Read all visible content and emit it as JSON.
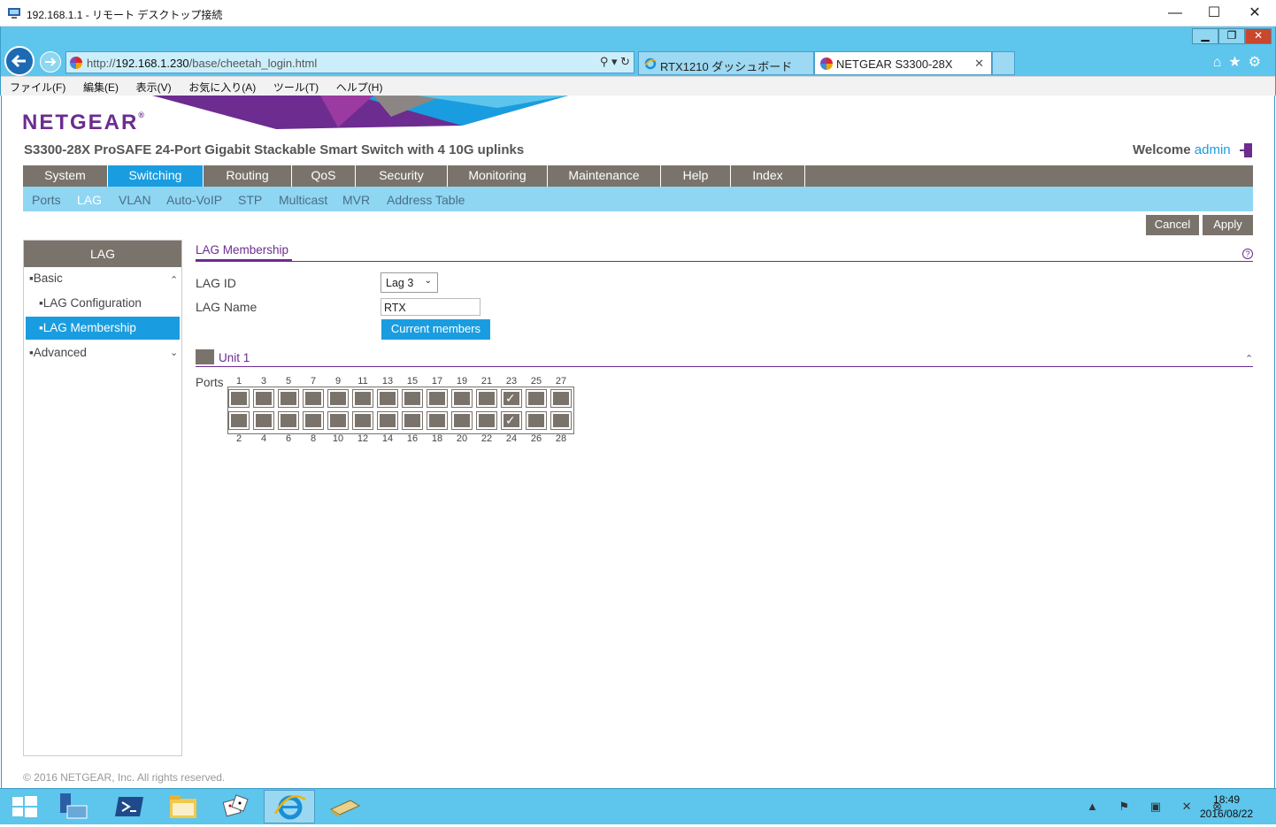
{
  "window": {
    "title": "192.168.1.1 - リモート デスクトップ接続",
    "minimize": "—",
    "maximize": "☐",
    "close": "✕"
  },
  "browser": {
    "url_prefix": "http://",
    "url_host": "192.168.1.230",
    "url_path": "/base/cheetah_login.html",
    "url_tools": "⚲ ▾ ↻",
    "inner_buttons": [
      "▁",
      "❐",
      "✕"
    ],
    "tabs": [
      {
        "label": "RTX1210 ダッシュボード",
        "active": false
      },
      {
        "label": "NETGEAR S3300-28X",
        "active": true,
        "close": "✕"
      }
    ],
    "right_icons": "⌂★⚙",
    "menu": [
      "ファイル(F)",
      "編集(E)",
      "表示(V)",
      "お気に入り(A)",
      "ツール(T)",
      "ヘルプ(H)"
    ]
  },
  "header": {
    "logo": "NETGEAR",
    "logo_reg": "®",
    "product": "S3300-28X ProSAFE 24-Port Gigabit Stackable Smart Switch with 4 10G uplinks",
    "welcome": "Welcome",
    "user": "admin"
  },
  "main_nav": [
    {
      "label": "System",
      "active": false
    },
    {
      "label": "Switching",
      "active": true
    },
    {
      "label": "Routing",
      "active": false
    },
    {
      "label": "QoS",
      "active": false
    },
    {
      "label": "Security",
      "active": false
    },
    {
      "label": "Monitoring",
      "active": false
    },
    {
      "label": "Maintenance",
      "active": false
    },
    {
      "label": "Help",
      "active": false
    },
    {
      "label": "Index",
      "active": false
    }
  ],
  "sub_nav": [
    {
      "label": "Ports",
      "active": false
    },
    {
      "label": "LAG",
      "active": true
    },
    {
      "label": "VLAN",
      "active": false
    },
    {
      "label": "Auto-VoIP",
      "active": false
    },
    {
      "label": "STP",
      "active": false
    },
    {
      "label": "Multicast",
      "active": false
    },
    {
      "label": "MVR",
      "active": false
    },
    {
      "label": "Address Table",
      "active": false
    }
  ],
  "actions": {
    "cancel": "Cancel",
    "apply": "Apply"
  },
  "sidebar": {
    "title": "LAG",
    "basic": "Basic",
    "lag_configuration": "LAG Configuration",
    "lag_membership": "LAG Membership",
    "advanced": "Advanced"
  },
  "content": {
    "section_title": "LAG Membership",
    "help": "?",
    "lag_id_label": "LAG ID",
    "lag_id_value": "Lag 3",
    "lag_name_label": "LAG Name",
    "lag_name_value": "RTX",
    "current_members_button": "Current members",
    "unit_label": "Unit 1",
    "ports_label": "Ports",
    "ports_top": [
      "1",
      "3",
      "5",
      "7",
      "9",
      "11",
      "13",
      "15",
      "17",
      "19",
      "21",
      "23",
      "25",
      "27"
    ],
    "ports_bottom": [
      "2",
      "4",
      "6",
      "8",
      "10",
      "12",
      "14",
      "16",
      "18",
      "20",
      "22",
      "24",
      "26",
      "28"
    ],
    "selected_ports": [
      "23",
      "24"
    ]
  },
  "footer": "© 2016 NETGEAR, Inc. All rights reserved.",
  "taskbar": {
    "tray": "▲ ⚑ ▣ ✕ ⊗",
    "time": "18:49",
    "date": "2016/08/22"
  },
  "colors": {
    "netgear_purple": "#6c2c90",
    "accent_blue": "#1a9de0",
    "nav_gray": "#7a736c",
    "subnav_blue": "#8fd6f3"
  }
}
